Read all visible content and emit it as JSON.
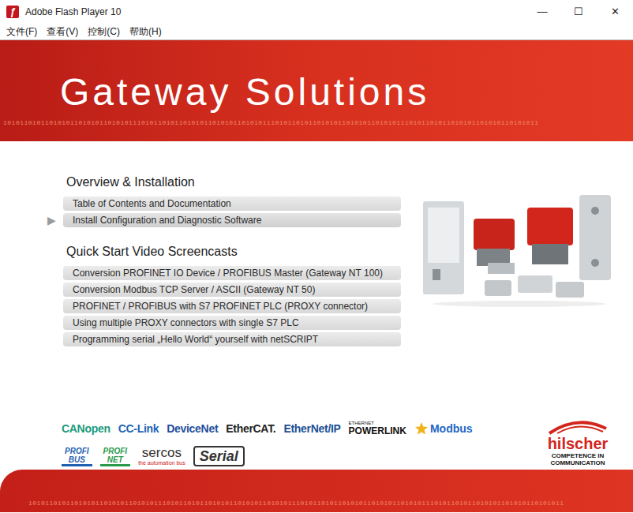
{
  "window": {
    "title": "Adobe Flash Player 10",
    "icon": "ƒ",
    "controls": [
      "—",
      "☐",
      "✕"
    ]
  },
  "menu": [
    "文件(F)",
    "查看(V)",
    "控制(C)",
    "帮助(H)"
  ],
  "header": {
    "title": "Gateway Solutions",
    "binary": "10101101011010101101010110101011101011010110101011010101101010111010110101101010110101011010101110101101011010101101010110101011"
  },
  "selection_marker": "▶",
  "sections": [
    {
      "heading": "Overview & Installation",
      "items": [
        {
          "label": "Table of Contents and Documentation",
          "selected": false
        },
        {
          "label": "Install Configuration and Diagnostic Software",
          "selected": true
        }
      ]
    },
    {
      "heading": "Quick Start Video Screencasts",
      "items": [
        {
          "label": "Conversion PROFINET IO Device / PROFIBUS Master (Gateway NT 100)",
          "selected": false
        },
        {
          "label": "Conversion Modbus TCP Server / ASCII (Gateway NT 50)",
          "selected": false
        },
        {
          "label": "PROFINET / PROFIBUS with S7 PROFINET PLC (PROXY connector)",
          "selected": false
        },
        {
          "label": "Using multiple PROXY connectors with single S7 PLC",
          "selected": false
        },
        {
          "label": "Programming serial „Hello World“ yourself with netSCRIPT",
          "selected": false
        }
      ]
    }
  ],
  "logos": [
    [
      {
        "lines": [
          "CANopen"
        ],
        "kind": "word",
        "color": "#1b9a7c"
      },
      {
        "lines": [
          "CC-Link"
        ],
        "kind": "word",
        "color": "#1e63b5"
      },
      {
        "lines": [
          "DeviceNet"
        ],
        "kind": "word",
        "color": "#1f4f9c"
      },
      {
        "lines": [
          "EtherCAT."
        ],
        "kind": "word",
        "color": "#222222"
      },
      {
        "lines": [
          "EtherNet/IP"
        ],
        "kind": "word",
        "color": "#1c4f95"
      },
      {
        "lines": [
          "ETHERNET",
          "POWERLINK"
        ],
        "kind": "small-top",
        "color": "#111111"
      },
      {
        "lines": [
          "Modbus"
        ],
        "kind": "star-word",
        "color": "#2266c4"
      }
    ],
    [
      {
        "lines": [
          "PROFI",
          "BUS"
        ],
        "kind": "stacked",
        "color": "#1f5fb0"
      },
      {
        "lines": [
          "PROFI",
          "NET"
        ],
        "kind": "stacked",
        "color": "#2a9a4a"
      },
      {
        "lines": [
          "sercos",
          "the automation bus"
        ],
        "kind": "small-bottom",
        "color": "#c8201a"
      },
      {
        "lines": [
          "Serial"
        ],
        "kind": "boxed-italic",
        "color": "#333333"
      }
    ]
  ],
  "brand": {
    "name": "hilscher",
    "tagline": [
      "COMPETENCE IN",
      "COMMUNICATION"
    ]
  },
  "footer": {
    "binary": "10101101011010101101010110101011101011010110101011010101101010111010110101101010110101011010101110101101011010101101010110101011"
  }
}
